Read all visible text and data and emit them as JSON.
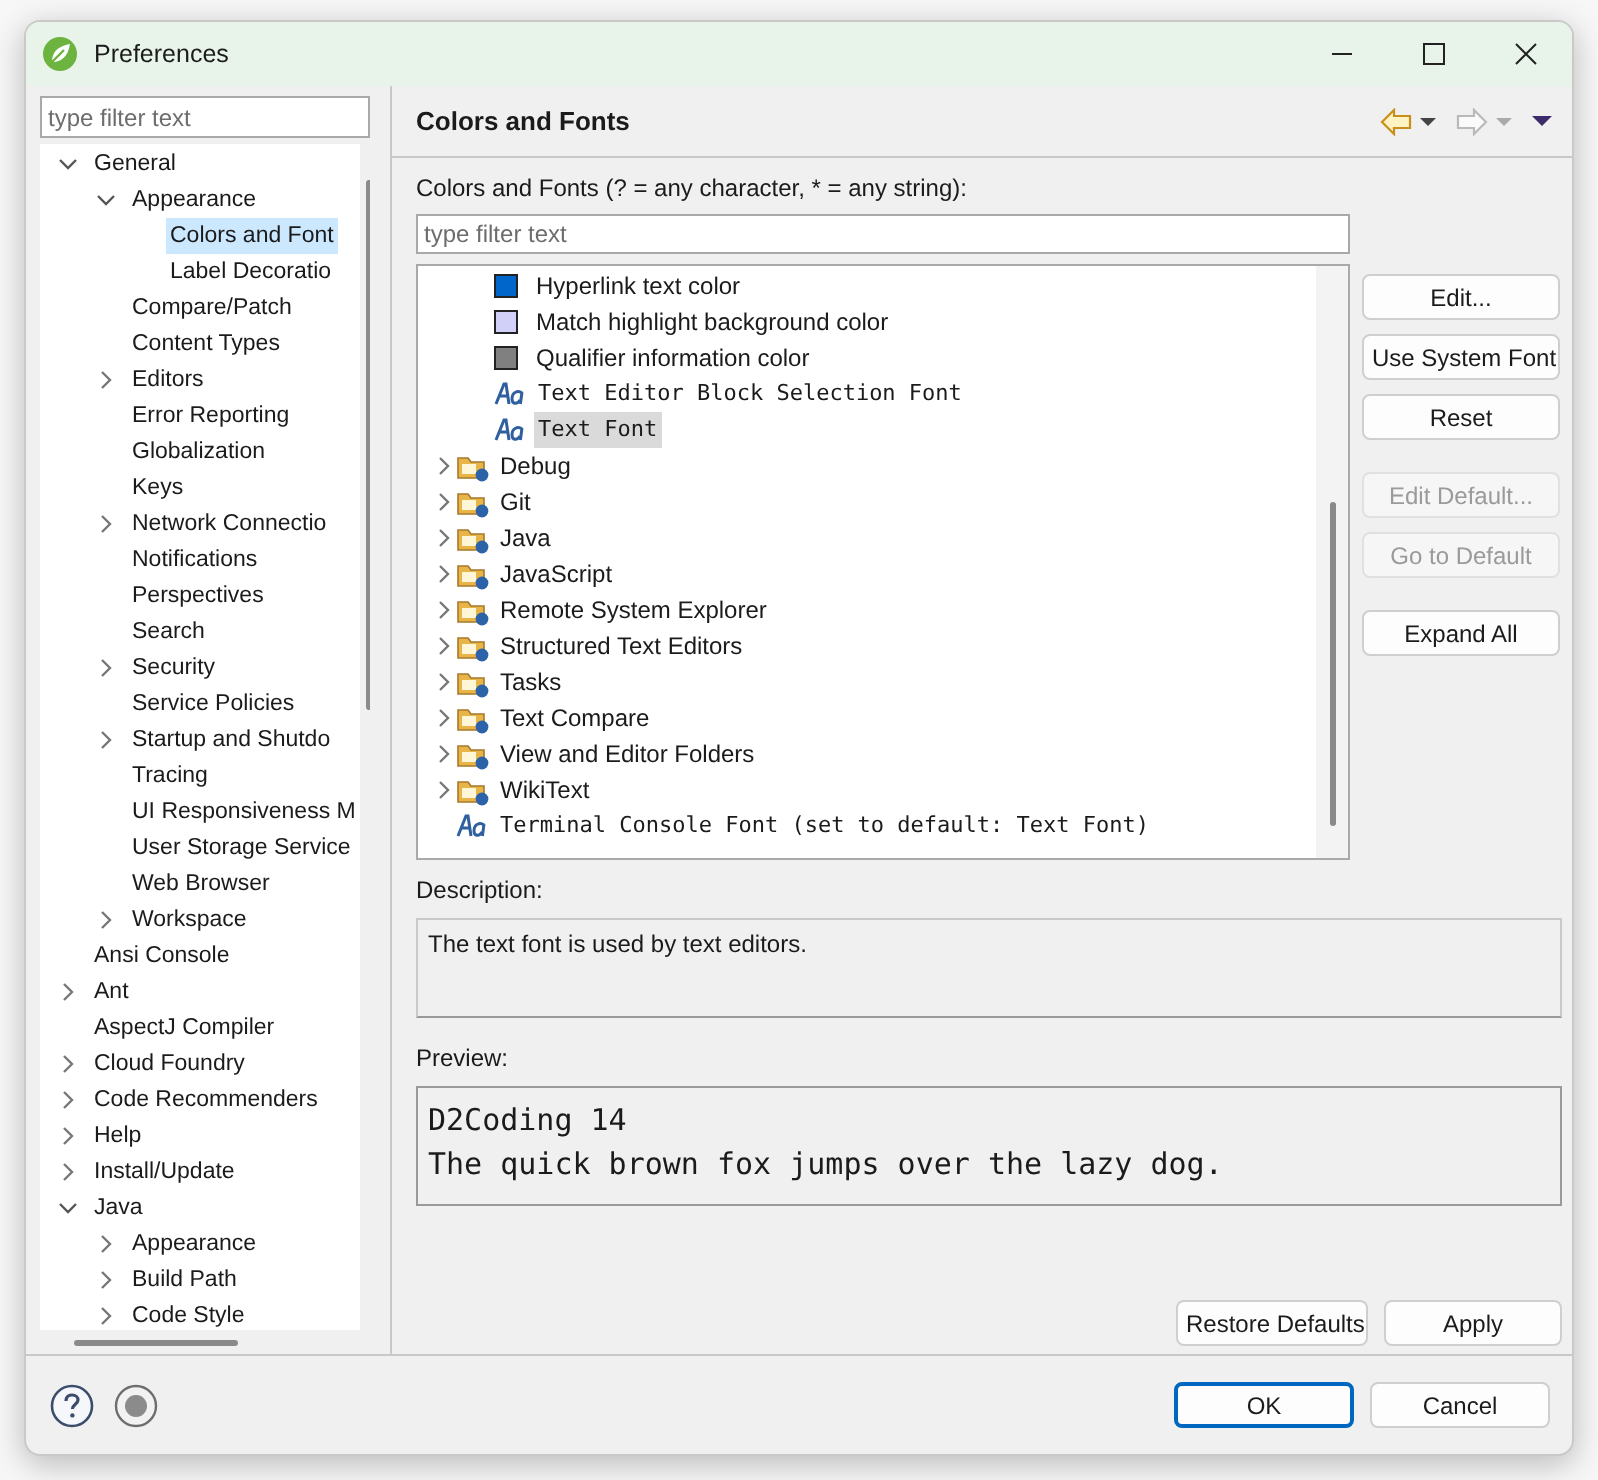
{
  "window": {
    "title": "Preferences"
  },
  "sidebar": {
    "filter": {
      "placeholder": "type filter text"
    },
    "tree": [
      {
        "label": "General",
        "expanded": true,
        "selected": false,
        "children": [
          {
            "label": "Appearance",
            "expanded": true,
            "selected": false,
            "children": [
              {
                "label": "Colors and Font",
                "selected": true
              },
              {
                "label": "Label Decoratio",
                "selected": false
              }
            ]
          },
          {
            "label": "Compare/Patch",
            "selected": false
          },
          {
            "label": "Content Types",
            "selected": false
          },
          {
            "label": "Editors",
            "expanded": false,
            "selected": false
          },
          {
            "label": "Error Reporting",
            "selected": false
          },
          {
            "label": "Globalization",
            "selected": false
          },
          {
            "label": "Keys",
            "selected": false
          },
          {
            "label": "Network Connectio",
            "expanded": false,
            "selected": false
          },
          {
            "label": "Notifications",
            "selected": false
          },
          {
            "label": "Perspectives",
            "selected": false
          },
          {
            "label": "Search",
            "selected": false
          },
          {
            "label": "Security",
            "expanded": false,
            "selected": false
          },
          {
            "label": "Service Policies",
            "selected": false
          },
          {
            "label": "Startup and Shutdo",
            "expanded": false,
            "selected": false
          },
          {
            "label": "Tracing",
            "selected": false
          },
          {
            "label": "UI Responsiveness M",
            "selected": false
          },
          {
            "label": "User Storage Service",
            "selected": false
          },
          {
            "label": "Web Browser",
            "selected": false
          },
          {
            "label": "Workspace",
            "expanded": false,
            "selected": false
          }
        ]
      },
      {
        "label": "Ansi Console",
        "selected": false
      },
      {
        "label": "Ant",
        "expanded": false,
        "selected": false
      },
      {
        "label": "AspectJ Compiler",
        "selected": false
      },
      {
        "label": "Cloud Foundry",
        "expanded": false,
        "selected": false
      },
      {
        "label": "Code Recommenders",
        "expanded": false,
        "selected": false
      },
      {
        "label": "Help",
        "expanded": false,
        "selected": false
      },
      {
        "label": "Install/Update",
        "expanded": false,
        "selected": false
      },
      {
        "label": "Java",
        "expanded": true,
        "selected": false,
        "children": [
          {
            "label": "Appearance",
            "expanded": false,
            "selected": false
          },
          {
            "label": "Build Path",
            "expanded": false,
            "selected": false
          },
          {
            "label": "Code Style",
            "expanded": false,
            "selected": false
          }
        ]
      }
    ]
  },
  "page": {
    "title": "Colors and Fonts",
    "filter_label": "Colors and Fonts (? = any character, * = any string):",
    "filter": {
      "placeholder": "type filter text"
    },
    "tree": {
      "continued_children": [
        {
          "kind": "color",
          "label": "Hyperlink text color",
          "color": "#0066cc",
          "selected": false
        },
        {
          "kind": "color",
          "label": "Match highlight background color",
          "color": "#d0d0f8",
          "selected": false
        },
        {
          "kind": "color",
          "label": "Qualifier information color",
          "color": "#808080",
          "selected": false
        },
        {
          "kind": "font",
          "label": "Text Editor Block Selection Font",
          "selected": false
        },
        {
          "kind": "font",
          "label": "Text Font",
          "selected": true
        }
      ],
      "items": [
        {
          "kind": "category",
          "label": "Debug",
          "expanded": false,
          "selected": false
        },
        {
          "kind": "category",
          "label": "Git",
          "expanded": false,
          "selected": false
        },
        {
          "kind": "category",
          "label": "Java",
          "expanded": false,
          "selected": false
        },
        {
          "kind": "category",
          "label": "JavaScript",
          "expanded": false,
          "selected": false
        },
        {
          "kind": "category",
          "label": "Remote System Explorer",
          "expanded": false,
          "selected": false
        },
        {
          "kind": "category",
          "label": "Structured Text Editors",
          "expanded": false,
          "selected": false
        },
        {
          "kind": "category",
          "label": "Tasks",
          "expanded": false,
          "selected": false
        },
        {
          "kind": "category",
          "label": "Text Compare",
          "expanded": false,
          "selected": false
        },
        {
          "kind": "category",
          "label": "View and Editor Folders",
          "expanded": false,
          "selected": false
        },
        {
          "kind": "category",
          "label": "WikiText",
          "expanded": false,
          "selected": false
        },
        {
          "kind": "font",
          "label": "Terminal Console Font (set to default: Text Font)",
          "selected": false
        }
      ]
    },
    "side_buttons": [
      {
        "label": "Edit...",
        "disabled": false
      },
      {
        "label": "Use System Font",
        "disabled": false
      },
      {
        "label": "Reset",
        "disabled": false
      },
      {
        "label": "Edit Default...",
        "disabled": true
      },
      {
        "label": "Go to Default",
        "disabled": true
      },
      {
        "label": "Expand All",
        "disabled": false
      }
    ],
    "description_label": "Description:",
    "description": "The text font is used by text editors.",
    "preview_label": "Preview:",
    "preview_lines": [
      "D2Coding 14",
      "The quick brown fox jumps over the lazy dog."
    ],
    "buttons": [
      {
        "label": "Restore Defaults"
      },
      {
        "label": "Apply"
      }
    ]
  },
  "footer": {
    "buttons": [
      {
        "label": "OK",
        "default": true
      },
      {
        "label": "Cancel",
        "default": false
      }
    ]
  }
}
